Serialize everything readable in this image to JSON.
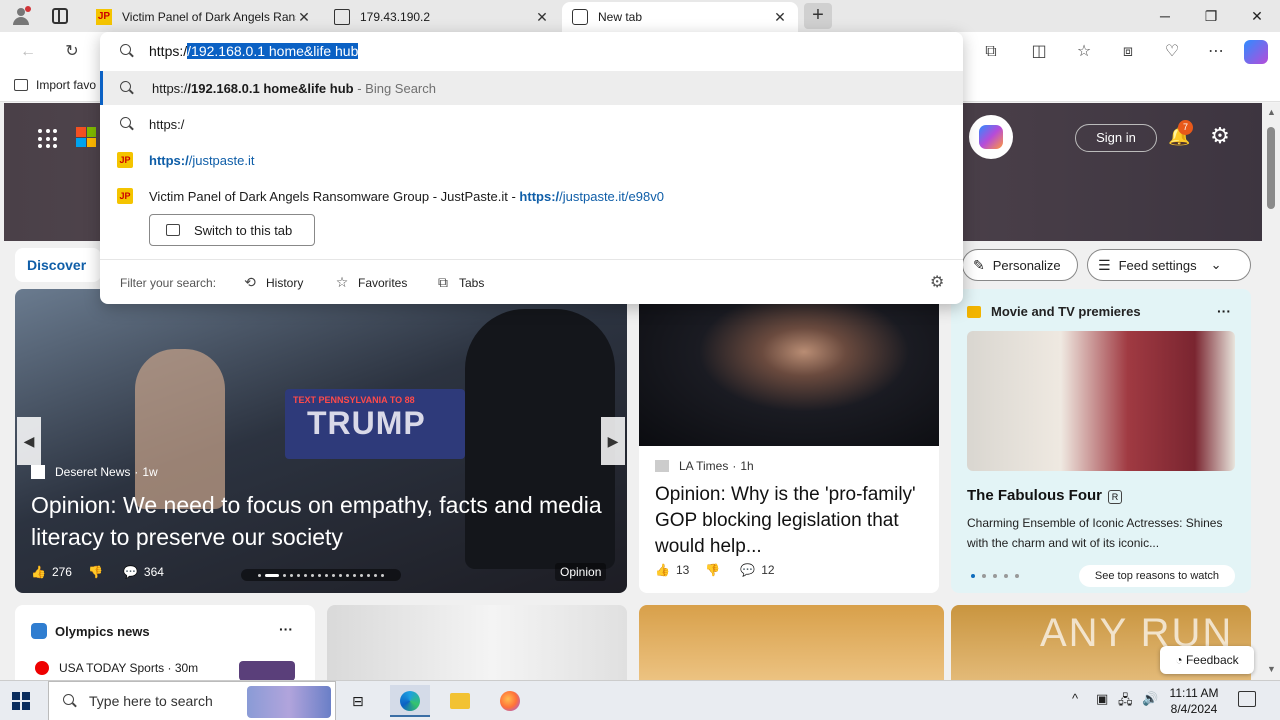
{
  "browser": {
    "tabs": [
      {
        "title": "Victim Panel of Dark Angels Ransomware Group - JustPaste.it",
        "favicon": "JP",
        "active": false
      },
      {
        "title": "179.43.190.2",
        "favicon": "file-icon",
        "active": false
      },
      {
        "title": "New tab",
        "favicon": "newtab-icon",
        "active": true
      }
    ],
    "new_tab_label": "+",
    "window_controls": {
      "minimize": "─",
      "maximize": "❐",
      "close": "✕"
    },
    "favorites_bar": {
      "import_label": "Import favo"
    }
  },
  "omnibox": {
    "typed_prefix": "https:/",
    "selected_suffix": "/192.168.0.1 home&life hub",
    "suggestions": [
      {
        "prefix": "https:/",
        "bold": "/192.168.0.1 home&life hub",
        "suffix": " - Bing Search"
      },
      {
        "text": "https:/"
      },
      {
        "link_bold": "https:/",
        "link_rest": "/justpaste.it"
      },
      {
        "title": "Victim Panel of Dark Angels Ransomware Group - JustPaste.it - ",
        "link_bold": "https:/",
        "link_rest": "/justpaste.it/e98v0"
      }
    ],
    "switch_tab_label": "Switch to this tab",
    "filter_label": "Filter your search:",
    "filters": [
      "History",
      "Favorites",
      "Tabs"
    ]
  },
  "newtab": {
    "sign_in": "Sign in",
    "notification_count": "7",
    "discover_label": "Discover",
    "personalize_label": "Personalize",
    "feed_settings_label": "Feed settings",
    "hero_sign": {
      "line1": "TEXT PENNSYLVANIA TO 88",
      "line2": "TRUMP"
    },
    "main_story": {
      "source": "Deseret News",
      "age": "1w",
      "headline": "Opinion: We need to focus on empathy, facts and media literacy to preserve our society",
      "likes": "276",
      "comments": "364",
      "tag": "Opinion"
    },
    "story2": {
      "source": "LA Times",
      "age": "1h",
      "headline": "Opinion: Why is the 'pro-family' GOP blocking legislation that would help...",
      "likes": "13",
      "comments": "12"
    },
    "movie_card": {
      "header": "Movie and TV premieres",
      "title": "The Fabulous Four",
      "rating": "R",
      "description": "Charming Ensemble of Iconic Actresses: Shines with the charm and wit of its iconic...",
      "cta": "See top reasons to watch"
    },
    "olympics": {
      "header": "Olympics news",
      "item": "USA TODAY Sports · 30m"
    },
    "watermark": "ANY RUN",
    "feedback_label": "Feedback"
  },
  "taskbar": {
    "search_placeholder": "Type here to search",
    "time": "11:11 AM",
    "date": "8/4/2024"
  },
  "colors": {
    "accent": "#0b61c4",
    "link": "#0f5ea8"
  }
}
